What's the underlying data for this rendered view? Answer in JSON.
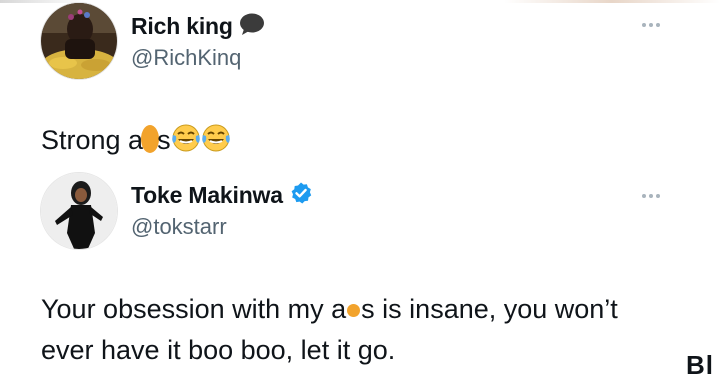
{
  "tweet1": {
    "name": "Rich king",
    "handle": "@RichKinq",
    "icon": "speech-balloon-icon",
    "text_part1": "Strong a",
    "text_part2": "s",
    "emojis": [
      "tears-of-joy-emoji",
      "tears-of-joy-emoji"
    ],
    "more_icon": "more-options-icon"
  },
  "tweet2": {
    "name": "Toke Makinwa",
    "handle": "@tokstarr",
    "verified_color": "#1d9bf0",
    "line1_part1": "Your obsession with my a",
    "line1_part2": "s is insane, you won’t",
    "line2": "ever have it boo boo, let it go.",
    "more_icon": "more-options-icon"
  },
  "censor_color": "#f2a32c",
  "corner_text": "Bl"
}
